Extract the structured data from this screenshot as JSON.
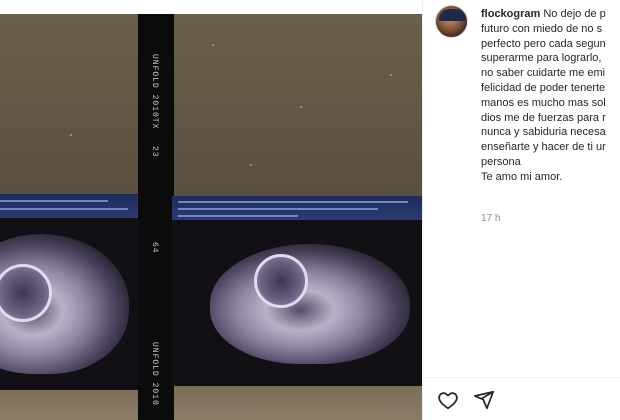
{
  "post": {
    "username": "flockogram",
    "caption": "No dejo de p\nfuturo con miedo de no s\nperfecto pero cada segun\nsuperarme para lograrlo,\nno saber cuidarte me emi\nfelicidad de poder tenerte\nmanos es mucho mas sol\ndios me de fuerzas para r\nnunca y sabiduria necesa\nenseñarte y hacer de ti ur\npersona\nTe amo mi amor.",
    "timestamp": "17 h"
  },
  "photo": {
    "film_text_top": "UNFOLD 2010TX",
    "film_number_top": "23",
    "film_number_mid": "64",
    "film_text_bottom": "UNFOLD 2010"
  },
  "actions": {
    "like_icon": "heart-icon",
    "share_icon": "send-icon"
  },
  "colors": {
    "text": "#262626",
    "muted": "#8e8e8e",
    "divider": "#efefef"
  }
}
